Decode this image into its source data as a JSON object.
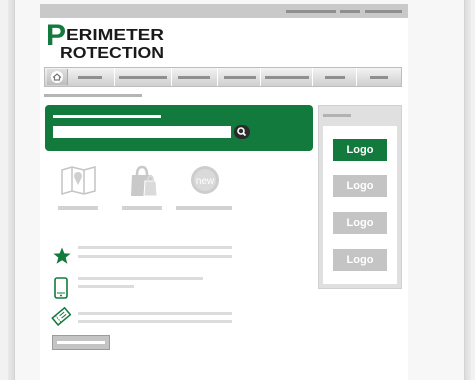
{
  "brand": {
    "line1_initial": "P",
    "line1_rest": "ERIMETER",
    "line2_rest": "ROTECTION",
    "color": "#137a3d"
  },
  "nav": {
    "home_icon": "home-icon"
  },
  "search": {
    "icon": "magnifier-icon",
    "placeholder": ""
  },
  "features": [
    {
      "icon": "map-icon"
    },
    {
      "icon": "shopping-bag-icon"
    },
    {
      "icon": "new-badge-icon",
      "badge_text": "new"
    }
  ],
  "info_list": [
    {
      "icon": "star-icon"
    },
    {
      "icon": "mobile-phone-icon"
    },
    {
      "icon": "ticket-icon"
    }
  ],
  "sidebar": {
    "logos": [
      {
        "label": "Logo",
        "state": "active",
        "color": "#137a3d"
      },
      {
        "label": "Logo",
        "state": "inactive",
        "color": "#c4c4c4"
      },
      {
        "label": "Logo",
        "state": "inactive",
        "color": "#c4c4c4"
      },
      {
        "label": "Logo",
        "state": "inactive",
        "color": "#c4c4c4"
      }
    ]
  },
  "colors": {
    "accent": "#137a3d",
    "placeholder_gray": "#c4c4c4"
  }
}
